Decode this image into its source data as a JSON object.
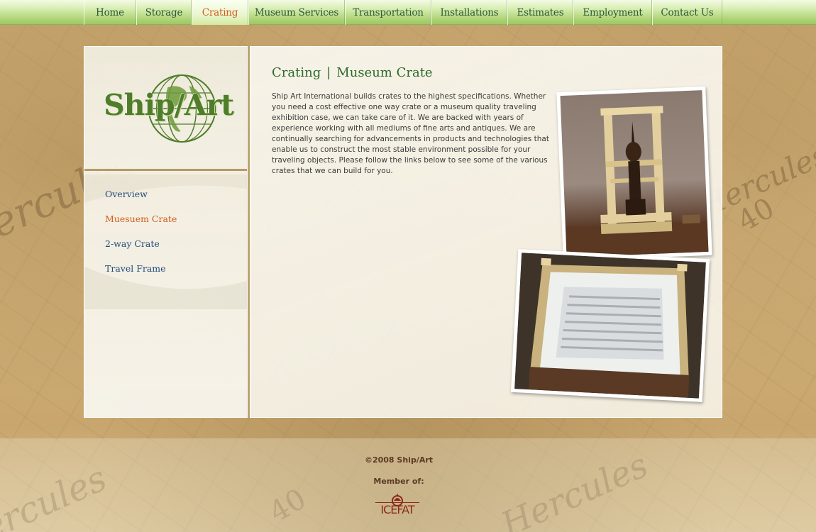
{
  "nav": {
    "items": [
      {
        "label": "Home"
      },
      {
        "label": "Storage"
      },
      {
        "label": "Crating"
      },
      {
        "label": "Museum Services"
      },
      {
        "label": "Transportation"
      },
      {
        "label": "Installations"
      },
      {
        "label": "Estimates"
      },
      {
        "label": "Employment"
      },
      {
        "label": "Contact Us"
      }
    ],
    "active": "Crating"
  },
  "logo": {
    "text": "Ship/Art"
  },
  "sidebar": {
    "items": [
      {
        "label": "Overview"
      },
      {
        "label": "Muesuem Crate"
      },
      {
        "label": "2-way Crate"
      },
      {
        "label": "Travel Frame"
      }
    ],
    "active": "Muesuem Crate"
  },
  "content": {
    "heading_section": "Crating",
    "heading_separator": "|",
    "heading_page": "Museum Crate",
    "body": "Ship Art International builds crates to the highest specifications. Whether you need a cost effective one way crate or a museum quality traveling exhibition case, we can take care of it. We are backed with years of experience working with all mediums of fine arts and antiques. We are continually searching for advancements in products and technologies that enable us to construct the most stable environment possible for your traveling objects. Please follow the links below to see some of the various crates that we can build for you."
  },
  "footer": {
    "copyright": "©2008 Ship/Art",
    "member_label": "Member of:",
    "member_logo": "ICEFAT"
  },
  "colors": {
    "nav_text": "#2f5a3a",
    "active": "#d45a1a",
    "sidebar_link": "#1f4a78",
    "heading": "#2b6a2b",
    "logo_green": "#4f7d2a"
  }
}
